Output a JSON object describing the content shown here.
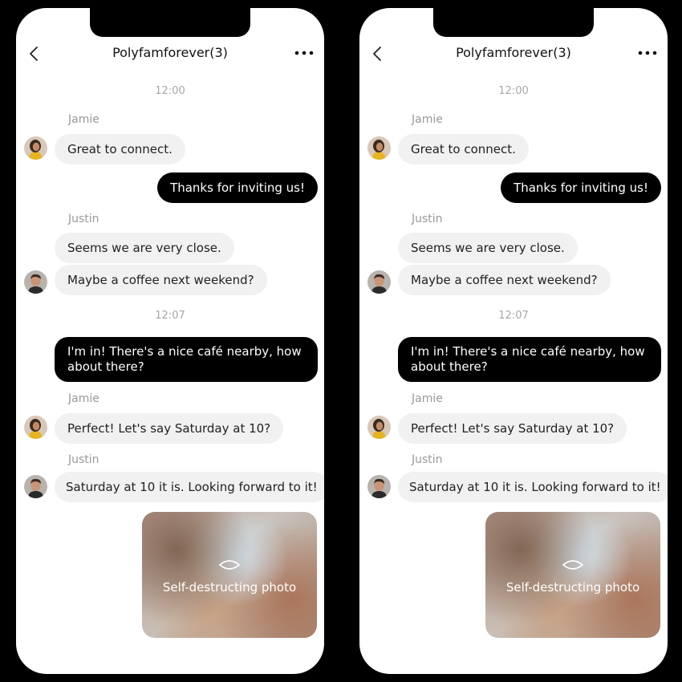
{
  "chat": {
    "title": "Polyfamforever(3)",
    "time_1": "12:00",
    "time_2": "12:07",
    "messages": [
      {
        "sender": "Jamie",
        "text": "Great to connect."
      },
      {
        "text": "Thanks for inviting us!"
      },
      {
        "sender": "Justin",
        "text": "Seems we are very close."
      },
      {
        "text": "Maybe a coffee next weekend?"
      },
      {
        "text": "I'm in! There's a nice café nearby, how about there?"
      },
      {
        "sender": "Jamie",
        "text": "Perfect! Let's say Saturday at 10?"
      },
      {
        "sender": "Justin",
        "text": "Saturday at 10 it is. Looking forward to it!"
      }
    ],
    "photo_label": "Self-destructing photo"
  },
  "icons": {
    "back": "chevron-left-icon",
    "menu": "more-dots-icon",
    "photo": "eye-closed-icon"
  },
  "colors": {
    "outgoing_bubble": "#000000",
    "incoming_bubble": "#f1f1f1",
    "background": "#000000"
  }
}
